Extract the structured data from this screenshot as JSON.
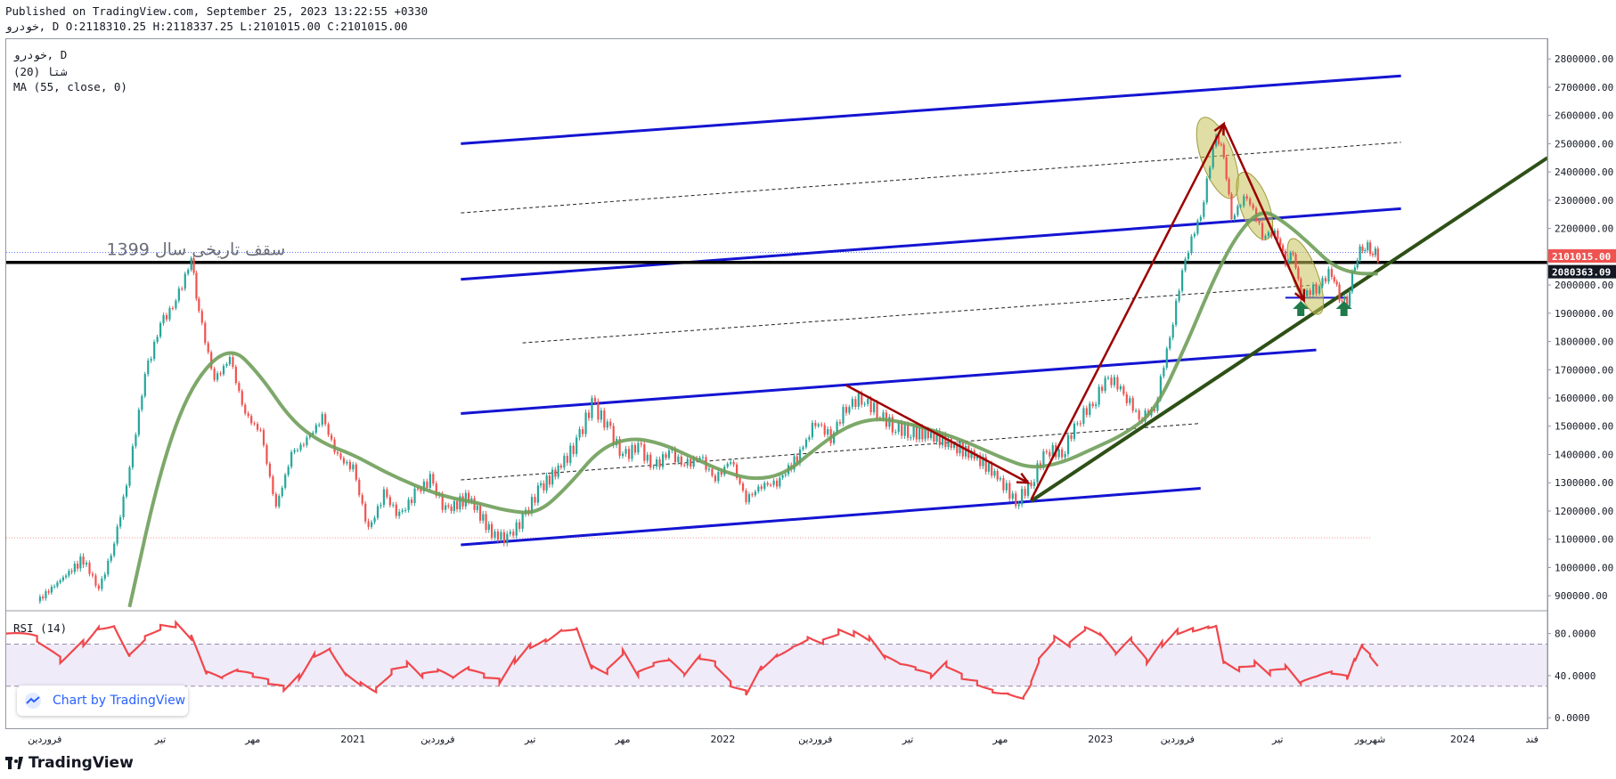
{
  "header": {
    "published": "Published on TradingView.com, September 25, 2023 13:22:55 +0330",
    "ohlc": "خودرو, D O:2118310.25 H:2118337.25 L:2101015.00 C:2101015.00"
  },
  "legend": {
    "line1": "خودرو, D",
    "line2": "(20) شتا",
    "line3": "MA (55, close, 0)"
  },
  "rsi_legend": "RSI (14)",
  "annotation_text": "سقف تاریخی سال 1399",
  "branding": {
    "logo_text": "TradingView",
    "badge_text": "Chart by TradingView"
  },
  "colors": {
    "up": "#26a69a",
    "down": "#ef5350",
    "ma": "#6f9e5a",
    "channel": "#1414d2",
    "trend": "#2d5016",
    "arrow": "#9b0000",
    "rsi": "#f0474c",
    "price_label": "#ef5350",
    "hline_label": "#131722"
  },
  "chart_data": [
    {
      "type": "line",
      "subtype": "candlestick",
      "ylim": [
        850000,
        2870000
      ],
      "y_ticks": [
        900000,
        1000000,
        1100000,
        1200000,
        1300000,
        1400000,
        1500000,
        1600000,
        1700000,
        1800000,
        1900000,
        2000000,
        2100000,
        2200000,
        2300000,
        2400000,
        2500000,
        2600000,
        2700000,
        2800000
      ],
      "y_tick_labels": [
        "900000.00",
        "1000000.00",
        "1100000.00",
        "1200000.00",
        "1300000.00",
        "1400000.00",
        "1500000.00",
        "1600000.00",
        "1700000.00",
        "1800000.00",
        "1900000.00",
        "2000000.00",
        "2100000.00",
        "2200000.00",
        "2300000.00",
        "2400000.00",
        "2500000.00",
        "2600000.00",
        "2700000.00",
        "2800000.00"
      ],
      "x_ticks": [
        0.025,
        0.1,
        0.16,
        0.225,
        0.28,
        0.34,
        0.4,
        0.465,
        0.525,
        0.585,
        0.645,
        0.71,
        0.76,
        0.825,
        0.885,
        0.945,
        0.99
      ],
      "x_tick_labels": [
        "فروردین",
        "تیر",
        "مهر",
        "2021",
        "فروردین",
        "تیر",
        "مهر",
        "2022",
        "فروردین",
        "تیر",
        "مهر",
        "2023",
        "فروردین",
        "تیر",
        "شهریور",
        "2024",
        "فند"
      ],
      "price_path": [
        [
          0.02,
          880000
        ],
        [
          0.05,
          1030000
        ],
        [
          0.06,
          920000
        ],
        [
          0.07,
          1080000
        ],
        [
          0.08,
          1350000
        ],
        [
          0.09,
          1680000
        ],
        [
          0.1,
          1860000
        ],
        [
          0.11,
          1940000
        ],
        [
          0.12,
          2090000
        ],
        [
          0.125,
          1900000
        ],
        [
          0.135,
          1660000
        ],
        [
          0.145,
          1740000
        ],
        [
          0.155,
          1540000
        ],
        [
          0.165,
          1480000
        ],
        [
          0.175,
          1210000
        ],
        [
          0.185,
          1400000
        ],
        [
          0.195,
          1450000
        ],
        [
          0.205,
          1530000
        ],
        [
          0.215,
          1390000
        ],
        [
          0.225,
          1350000
        ],
        [
          0.235,
          1130000
        ],
        [
          0.245,
          1260000
        ],
        [
          0.255,
          1180000
        ],
        [
          0.265,
          1260000
        ],
        [
          0.275,
          1310000
        ],
        [
          0.285,
          1200000
        ],
        [
          0.3,
          1250000
        ],
        [
          0.315,
          1120000
        ],
        [
          0.325,
          1100000
        ],
        [
          0.335,
          1170000
        ],
        [
          0.345,
          1270000
        ],
        [
          0.36,
          1360000
        ],
        [
          0.37,
          1440000
        ],
        [
          0.38,
          1580000
        ],
        [
          0.39,
          1500000
        ],
        [
          0.4,
          1390000
        ],
        [
          0.41,
          1430000
        ],
        [
          0.42,
          1350000
        ],
        [
          0.43,
          1410000
        ],
        [
          0.44,
          1360000
        ],
        [
          0.45,
          1390000
        ],
        [
          0.46,
          1310000
        ],
        [
          0.47,
          1380000
        ],
        [
          0.48,
          1240000
        ],
        [
          0.49,
          1290000
        ],
        [
          0.5,
          1300000
        ],
        [
          0.515,
          1400000
        ],
        [
          0.525,
          1520000
        ],
        [
          0.535,
          1460000
        ],
        [
          0.545,
          1570000
        ],
        [
          0.555,
          1600000
        ],
        [
          0.565,
          1550000
        ],
        [
          0.575,
          1500000
        ],
        [
          0.585,
          1480000
        ],
        [
          0.6,
          1470000
        ],
        [
          0.615,
          1430000
        ],
        [
          0.63,
          1390000
        ],
        [
          0.645,
          1310000
        ],
        [
          0.655,
          1230000
        ],
        [
          0.665,
          1300000
        ],
        [
          0.675,
          1420000
        ],
        [
          0.685,
          1400000
        ],
        [
          0.695,
          1520000
        ],
        [
          0.705,
          1580000
        ],
        [
          0.715,
          1680000
        ],
        [
          0.725,
          1620000
        ],
        [
          0.735,
          1530000
        ],
        [
          0.745,
          1560000
        ],
        [
          0.755,
          1820000
        ],
        [
          0.765,
          2100000
        ],
        [
          0.775,
          2250000
        ],
        [
          0.785,
          2540000
        ],
        [
          0.79,
          2460000
        ],
        [
          0.795,
          2240000
        ],
        [
          0.805,
          2320000
        ],
        [
          0.815,
          2180000
        ],
        [
          0.825,
          2180000
        ],
        [
          0.83,
          2080000
        ],
        [
          0.835,
          2120000
        ],
        [
          0.84,
          1960000
        ],
        [
          0.85,
          1990000
        ],
        [
          0.86,
          2050000
        ],
        [
          0.865,
          1960000
        ],
        [
          0.87,
          1940000
        ],
        [
          0.875,
          2080000
        ],
        [
          0.88,
          2140000
        ],
        [
          0.885,
          2130000
        ],
        [
          0.89,
          2101015
        ]
      ],
      "ma_path": [
        [
          0.08,
          860000
        ],
        [
          0.1,
          1350000
        ],
        [
          0.12,
          1650000
        ],
        [
          0.145,
          1790000
        ],
        [
          0.165,
          1680000
        ],
        [
          0.185,
          1520000
        ],
        [
          0.205,
          1440000
        ],
        [
          0.225,
          1400000
        ],
        [
          0.245,
          1340000
        ],
        [
          0.265,
          1290000
        ],
        [
          0.285,
          1250000
        ],
        [
          0.305,
          1230000
        ],
        [
          0.325,
          1200000
        ],
        [
          0.345,
          1190000
        ],
        [
          0.365,
          1290000
        ],
        [
          0.385,
          1420000
        ],
        [
          0.405,
          1460000
        ],
        [
          0.425,
          1440000
        ],
        [
          0.445,
          1390000
        ],
        [
          0.465,
          1340000
        ],
        [
          0.485,
          1310000
        ],
        [
          0.505,
          1330000
        ],
        [
          0.525,
          1420000
        ],
        [
          0.545,
          1500000
        ],
        [
          0.565,
          1530000
        ],
        [
          0.585,
          1510000
        ],
        [
          0.605,
          1480000
        ],
        [
          0.625,
          1440000
        ],
        [
          0.645,
          1390000
        ],
        [
          0.665,
          1350000
        ],
        [
          0.685,
          1370000
        ],
        [
          0.705,
          1420000
        ],
        [
          0.725,
          1470000
        ],
        [
          0.745,
          1550000
        ],
        [
          0.765,
          1780000
        ],
        [
          0.785,
          2040000
        ],
        [
          0.8,
          2190000
        ],
        [
          0.815,
          2270000
        ],
        [
          0.83,
          2220000
        ],
        [
          0.845,
          2150000
        ],
        [
          0.86,
          2070000
        ],
        [
          0.875,
          2040000
        ],
        [
          0.89,
          2040000
        ]
      ],
      "lines": [
        {
          "kind": "channel",
          "from": [
            0.295,
            2500000
          ],
          "to": [
            0.905,
            2740000
          ]
        },
        {
          "kind": "channel",
          "from": [
            0.295,
            2020000
          ],
          "to": [
            0.905,
            2270000
          ]
        },
        {
          "kind": "channel",
          "from": [
            0.295,
            1545000
          ],
          "to": [
            0.85,
            1770000
          ]
        },
        {
          "kind": "channel",
          "from": [
            0.295,
            1080000
          ],
          "to": [
            0.775,
            1280000
          ]
        },
        {
          "kind": "dashed",
          "from": [
            0.295,
            2255000
          ],
          "to": [
            0.905,
            2505000
          ]
        },
        {
          "kind": "dashed",
          "from": [
            0.335,
            1795000
          ],
          "to": [
            0.85,
            2000000
          ]
        },
        {
          "kind": "dashed",
          "from": [
            0.295,
            1310000
          ],
          "to": [
            0.775,
            1510000
          ]
        },
        {
          "kind": "horizontal",
          "y": 2080000
        },
        {
          "kind": "short",
          "from": [
            0.83,
            1955000
          ],
          "to": [
            0.87,
            1955000
          ]
        },
        {
          "kind": "trend",
          "from": [
            0.665,
            1235000
          ],
          "to": [
            1.0,
            2450000
          ]
        }
      ],
      "arrows": [
        {
          "from": [
            0.545,
            1645000
          ],
          "to": [
            0.663,
            1300000
          ]
        },
        {
          "from": [
            0.665,
            1240000
          ],
          "to": [
            0.79,
            2570000
          ]
        },
        {
          "from": [
            0.79,
            2570000
          ],
          "to": [
            0.842,
            1945000
          ]
        }
      ],
      "ellipses": [
        [
          0.786,
          2450000,
          18,
          48
        ],
        [
          0.81,
          2280000,
          16,
          40
        ],
        [
          0.843,
          2030000,
          14,
          45
        ]
      ],
      "markers": [
        [
          0.84,
          1915000
        ],
        [
          0.868,
          1915000
        ]
      ],
      "price_label": "2101015.00",
      "hline_label": "2080363.09"
    },
    {
      "type": "line",
      "name": "RSI (14)",
      "ylim": [
        -10,
        100
      ],
      "y_ticks": [
        0,
        40,
        80
      ],
      "y_tick_labels": [
        "0.0000",
        "40.0000",
        "80.0000"
      ],
      "band": [
        30,
        70
      ],
      "values": [
        [
          0.0,
          80
        ],
        [
          0.02,
          74
        ],
        [
          0.035,
          55
        ],
        [
          0.05,
          72
        ],
        [
          0.06,
          88
        ],
        [
          0.07,
          90
        ],
        [
          0.08,
          62
        ],
        [
          0.09,
          78
        ],
        [
          0.1,
          87
        ],
        [
          0.11,
          88
        ],
        [
          0.12,
          75
        ],
        [
          0.13,
          40
        ],
        [
          0.14,
          35
        ],
        [
          0.15,
          42
        ],
        [
          0.16,
          38
        ],
        [
          0.17,
          33
        ],
        [
          0.18,
          28
        ],
        [
          0.19,
          40
        ],
        [
          0.2,
          62
        ],
        [
          0.21,
          68
        ],
        [
          0.22,
          45
        ],
        [
          0.23,
          35
        ],
        [
          0.24,
          28
        ],
        [
          0.25,
          44
        ],
        [
          0.26,
          50
        ],
        [
          0.27,
          38
        ],
        [
          0.28,
          42
        ],
        [
          0.29,
          35
        ],
        [
          0.3,
          44
        ],
        [
          0.31,
          38
        ],
        [
          0.32,
          34
        ],
        [
          0.33,
          55
        ],
        [
          0.34,
          70
        ],
        [
          0.35,
          76
        ],
        [
          0.36,
          86
        ],
        [
          0.37,
          88
        ],
        [
          0.38,
          50
        ],
        [
          0.39,
          45
        ],
        [
          0.4,
          62
        ],
        [
          0.41,
          40
        ],
        [
          0.42,
          48
        ],
        [
          0.43,
          52
        ],
        [
          0.44,
          38
        ],
        [
          0.45,
          55
        ],
        [
          0.46,
          50
        ],
        [
          0.47,
          32
        ],
        [
          0.48,
          25
        ],
        [
          0.49,
          50
        ],
        [
          0.5,
          62
        ],
        [
          0.51,
          70
        ],
        [
          0.52,
          78
        ],
        [
          0.53,
          74
        ],
        [
          0.54,
          82
        ],
        [
          0.55,
          79
        ],
        [
          0.56,
          73
        ],
        [
          0.57,
          55
        ],
        [
          0.58,
          48
        ],
        [
          0.59,
          44
        ],
        [
          0.6,
          38
        ],
        [
          0.61,
          50
        ],
        [
          0.62,
          40
        ],
        [
          0.63,
          35
        ],
        [
          0.64,
          28
        ],
        [
          0.65,
          26
        ],
        [
          0.66,
          22
        ],
        [
          0.665,
          35
        ],
        [
          0.67,
          55
        ],
        [
          0.68,
          75
        ],
        [
          0.69,
          68
        ],
        [
          0.7,
          82
        ],
        [
          0.71,
          76
        ],
        [
          0.72,
          58
        ],
        [
          0.73,
          72
        ],
        [
          0.74,
          52
        ],
        [
          0.75,
          70
        ],
        [
          0.76,
          83
        ],
        [
          0.77,
          86
        ],
        [
          0.78,
          89
        ],
        [
          0.785,
          91
        ],
        [
          0.79,
          55
        ],
        [
          0.8,
          48
        ],
        [
          0.81,
          52
        ],
        [
          0.82,
          42
        ],
        [
          0.83,
          46
        ],
        [
          0.84,
          30
        ],
        [
          0.85,
          36
        ],
        [
          0.86,
          40
        ],
        [
          0.87,
          36
        ],
        [
          0.875,
          55
        ],
        [
          0.88,
          70
        ],
        [
          0.885,
          62
        ],
        [
          0.89,
          52
        ]
      ]
    }
  ]
}
